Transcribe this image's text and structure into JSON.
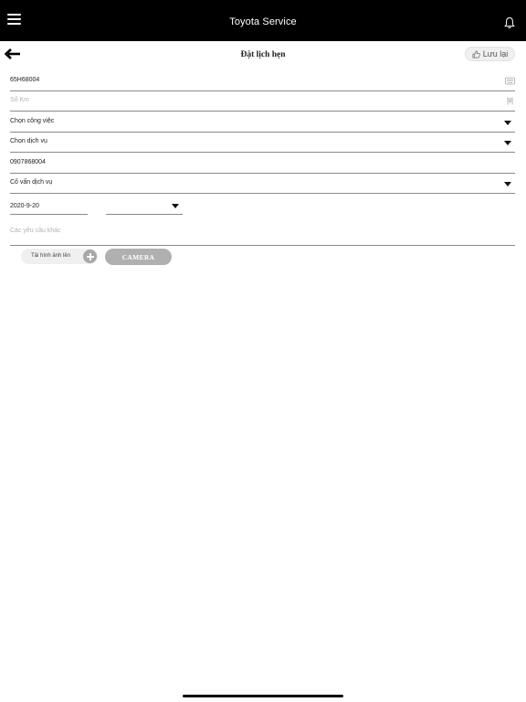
{
  "header": {
    "app_title": "Toyota Service"
  },
  "subheader": {
    "page_title": "Đặt lịch hẹn",
    "save_label": "Lưu lại"
  },
  "form": {
    "plate_number": {
      "value": "65H68004"
    },
    "odometer": {
      "placeholder": "Số Km"
    },
    "job": {
      "value": "Chọn công việc"
    },
    "service": {
      "value": "Chọn dịch vụ"
    },
    "phone": {
      "value": "0907868004"
    },
    "advisor": {
      "value": "Cố vấn dịch vụ"
    },
    "date": {
      "value": "2020-9-20"
    },
    "time": {
      "value": ""
    },
    "notes": {
      "placeholder": "Các yêu cầu khác"
    }
  },
  "actions": {
    "upload_label": "Tải hình ảnh lên",
    "camera_label": "CAMERA"
  }
}
